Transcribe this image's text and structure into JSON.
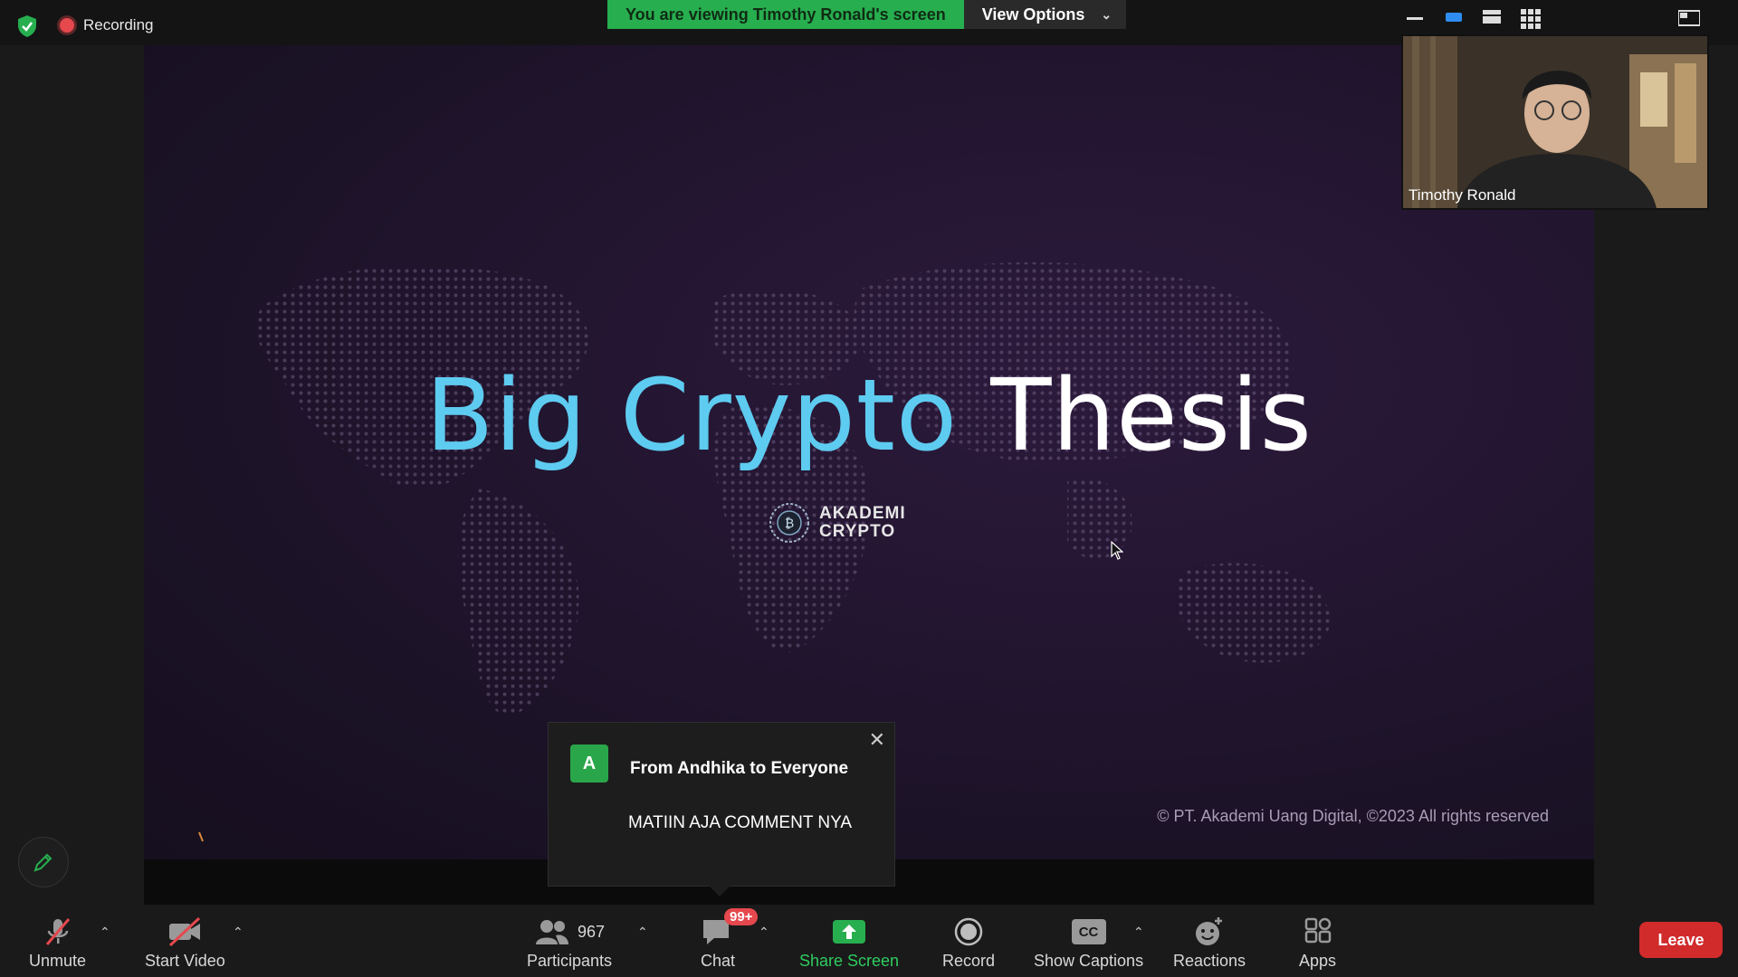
{
  "status": {
    "recording_label": "Recording"
  },
  "share_banner": {
    "viewing_text": "You are viewing Timothy Ronald's screen",
    "view_options_label": "View Options"
  },
  "slide": {
    "title_part1": "Big Crypto",
    "title_part2": "Thesis",
    "brand_line1": "AKADEMI",
    "brand_line2": "CRYPTO",
    "copyright": "© PT. Akademi Uang Digital, ©2023 All rights reserved"
  },
  "speaker": {
    "name": "Timothy Ronald"
  },
  "chat_popup": {
    "avatar_letter": "A",
    "from": "From Andhika to Everyone",
    "message": "MATIIN AJA COMMENT NYA"
  },
  "toolbar": {
    "unmute": "Unmute",
    "start_video": "Start Video",
    "participants_count": "967",
    "participants": "Participants",
    "chat": "Chat",
    "chat_badge": "99+",
    "share_screen": "Share Screen",
    "record": "Record",
    "show_captions": "Show Captions",
    "cc": "CC",
    "reactions": "Reactions",
    "apps": "Apps",
    "leave": "Leave"
  },
  "colors": {
    "accent_green": "#27ae4f",
    "title_blue": "#5ecbf0",
    "leave_red": "#d12b2b"
  }
}
